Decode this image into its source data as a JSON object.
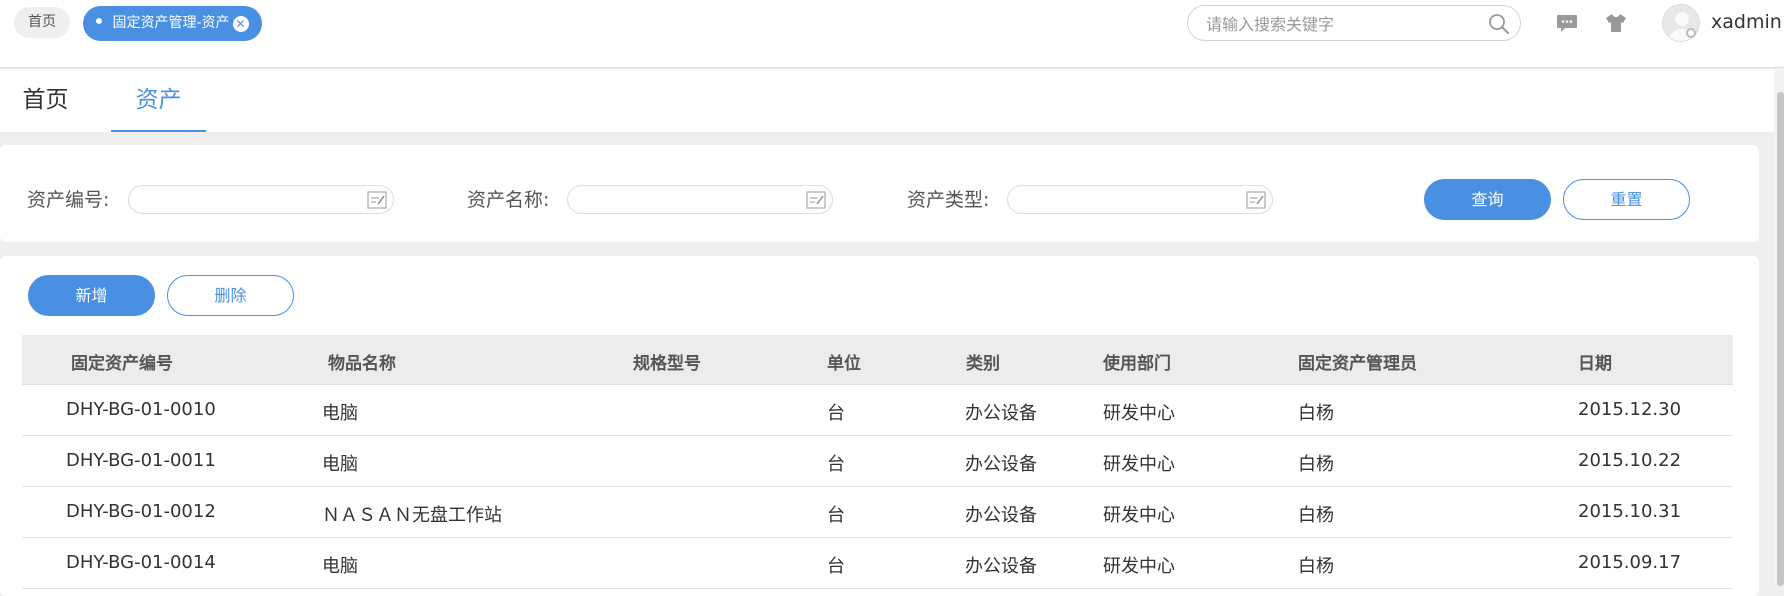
{
  "topbar": {
    "home_tag": "首页",
    "active_tag": "固定资产管理-资产",
    "search_placeholder": "请输入搜索关键字",
    "username": "xadmin"
  },
  "tabs": [
    {
      "label": "首页"
    },
    {
      "label": "资产"
    }
  ],
  "filters": {
    "asset_no_label": "资产编号:",
    "asset_name_label": "资产名称:",
    "asset_type_label": "资产类型:",
    "query_button": "查询",
    "reset_button": "重置"
  },
  "toolbar": {
    "add_button": "新增",
    "delete_button": "删除"
  },
  "table": {
    "headers": [
      "固定资产编号",
      "物品名称",
      "规格型号",
      "单位",
      "类别",
      "使用部门",
      "固定资产管理员",
      "日期"
    ],
    "rows": [
      [
        "DHY-BG-01-0010",
        "电脑",
        "",
        "台",
        "办公设备",
        "研发中心",
        "白杨",
        "2015.12.30"
      ],
      [
        "DHY-BG-01-0011",
        "电脑",
        "",
        "台",
        "办公设备",
        "研发中心",
        "白杨",
        "2015.10.22"
      ],
      [
        "DHY-BG-01-0012",
        "ＮＡＳＡＮ无盘工作站",
        "",
        "台",
        "办公设备",
        "研发中心",
        "白杨",
        "2015.10.31"
      ],
      [
        "DHY-BG-01-0014",
        "电脑",
        "",
        "台",
        "办公设备",
        "研发中心",
        "白杨",
        "2015.09.17"
      ]
    ]
  },
  "colors": {
    "accent": "#4a90e2",
    "page_bg": "#efefef",
    "header_bg": "#ececec"
  },
  "icons": [
    "close-icon",
    "search-icon",
    "message-icon",
    "shirt-icon",
    "avatar",
    "edit-icon"
  ]
}
